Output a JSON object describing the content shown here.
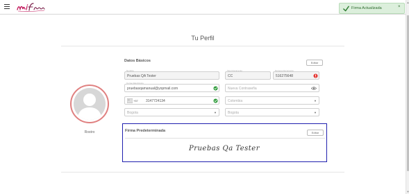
{
  "topbar": {
    "logo_text": "mifirma",
    "toast_text": "Firma Actualizada",
    "toast_close": "×"
  },
  "scrollbar": {
    "up_arrow": "▲",
    "down_arrow": "▼"
  },
  "page": {
    "title": "Tu Perfil"
  },
  "profile": {
    "avatar_label": "Rostro"
  },
  "datos_basicos": {
    "title": "Datos Básicos",
    "edit_label": "Editar",
    "fields": {
      "nombre": {
        "label": "Nombre",
        "value": "Pruebas QA Tester"
      },
      "tipo_documento": {
        "label": "Tipo Documento",
        "value": "CC"
      },
      "numero_documento": {
        "label": "Número Documento",
        "value": "516275648"
      },
      "correo": {
        "label": "Correo Electrónico",
        "value": "pruebasqamanual@yopmail.com"
      },
      "contrasena": {
        "placeholder": "Nueva Contraseña"
      },
      "telefono": {
        "prefix": "+57",
        "value": "3147724134"
      },
      "pais": {
        "value": "Colombia"
      },
      "departamento": {
        "value": "Bogota"
      },
      "ciudad": {
        "value": "Bogota"
      }
    }
  },
  "firma": {
    "title": "Firma Predeterminada",
    "edit_label": "Editar",
    "signature_text": "Pruebas Qa Tester"
  },
  "colors": {
    "accent_pink": "#c2185b",
    "valid_green": "#2e9b3a",
    "error_red": "#e53935",
    "highlight_blue": "#1f1fae"
  }
}
